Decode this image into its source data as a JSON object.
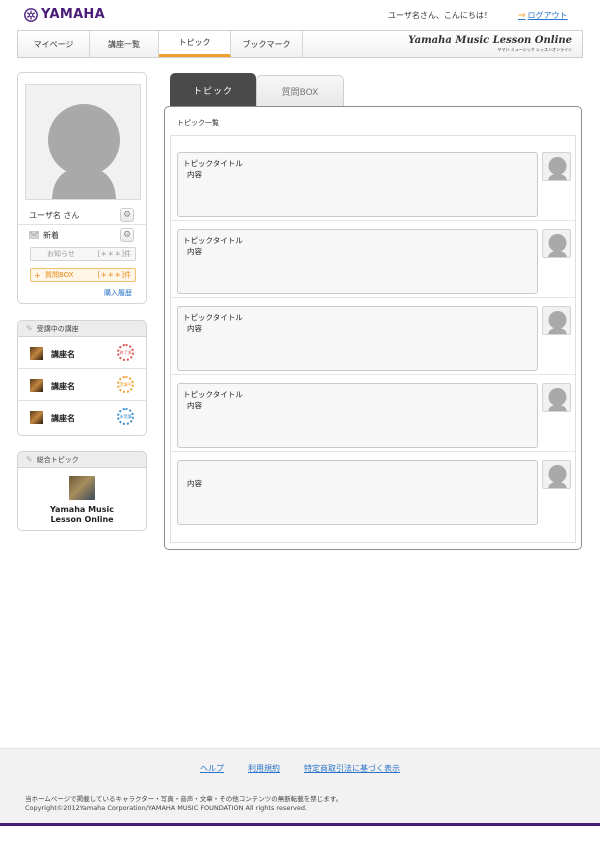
{
  "header": {
    "logo_text": "YAMAHA",
    "greeting": "ユーザ名さん、こんにちは！",
    "logout_label": "ログアウト"
  },
  "nav": {
    "items": [
      {
        "label": "マイページ"
      },
      {
        "label": "講座一覧"
      },
      {
        "label": "トピック",
        "active": true
      },
      {
        "label": "ブックマーク"
      }
    ],
    "brand_main": "Yamaha Music Lesson Online",
    "brand_sub": "ヤマハ ミュージック レッスンオンライン"
  },
  "profile": {
    "user_name": "ユーザ名 さん",
    "new_label": "新着",
    "notice_label": "お知らせ",
    "notice_count": "[＊＊＊]件",
    "question_box_label": "質問BOX",
    "question_box_count": "[＊＊＊]件",
    "purchase_history_label": "購入履歴"
  },
  "courses": {
    "header": "受講中の講座",
    "items": [
      {
        "name": "講座名",
        "stamp_color": "#d9534f",
        "stamp_text": "修了済"
      },
      {
        "name": "講座名",
        "stamp_color": "#f0a030",
        "stamp_text": "受講中"
      },
      {
        "name": "講座名",
        "stamp_color": "#3a8fd0",
        "stamp_text": "未受講"
      }
    ]
  },
  "general_topics": {
    "header": "総合トピック",
    "name_line1": "Yamaha Music",
    "name_line2": "Lesson Online"
  },
  "main": {
    "tab_active": "トピック",
    "tab_inactive": "質問BOX",
    "panel_title": "トピック一覧",
    "topics": [
      {
        "title": "トピックタイトル",
        "content": "内容"
      },
      {
        "title": "トピックタイトル",
        "content": "内容"
      },
      {
        "title": "トピックタイトル",
        "content": "内容"
      },
      {
        "title": "トピックタイトル",
        "content": "内容"
      },
      {
        "title": "",
        "content": "内容"
      }
    ]
  },
  "footer": {
    "links": [
      "ヘルプ",
      "利用規約",
      "特定商取引法に基づく表示"
    ],
    "notice": "当ホームページで掲載しているキャラクター・写真・音声・文章・その他コンテンツの無断転載を禁じます。",
    "copyright": "Copyright©2012Yamaha Corporation/YAMAHA MUSIC FOUNDATION All rights reserved."
  },
  "colors": {
    "brand_purple": "#4a1c7a",
    "accent_orange": "#f0a030",
    "link_blue": "#2a73c8"
  }
}
